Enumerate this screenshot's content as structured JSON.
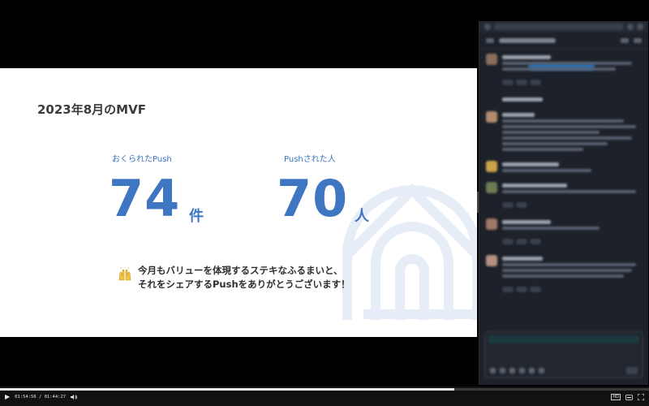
{
  "slide": {
    "title": "2023年8月のMVF",
    "stats": [
      {
        "label": "おくられたPush",
        "value": "74",
        "unit": "件"
      },
      {
        "label": "Pushされた人",
        "value": "70",
        "unit": "人"
      }
    ],
    "message_line1": "今月もバリューを体現するステキなふるまいと、",
    "message_line2": "それをシェアするPushをありがとうございます！"
  },
  "player": {
    "time": "01:54:56 / 01:44:27",
    "progress": 0.7,
    "hd_label": "HD"
  },
  "colors": {
    "accent": "#3f76c2",
    "chat_bg": "#1d2129",
    "player_bg": "#111111"
  }
}
